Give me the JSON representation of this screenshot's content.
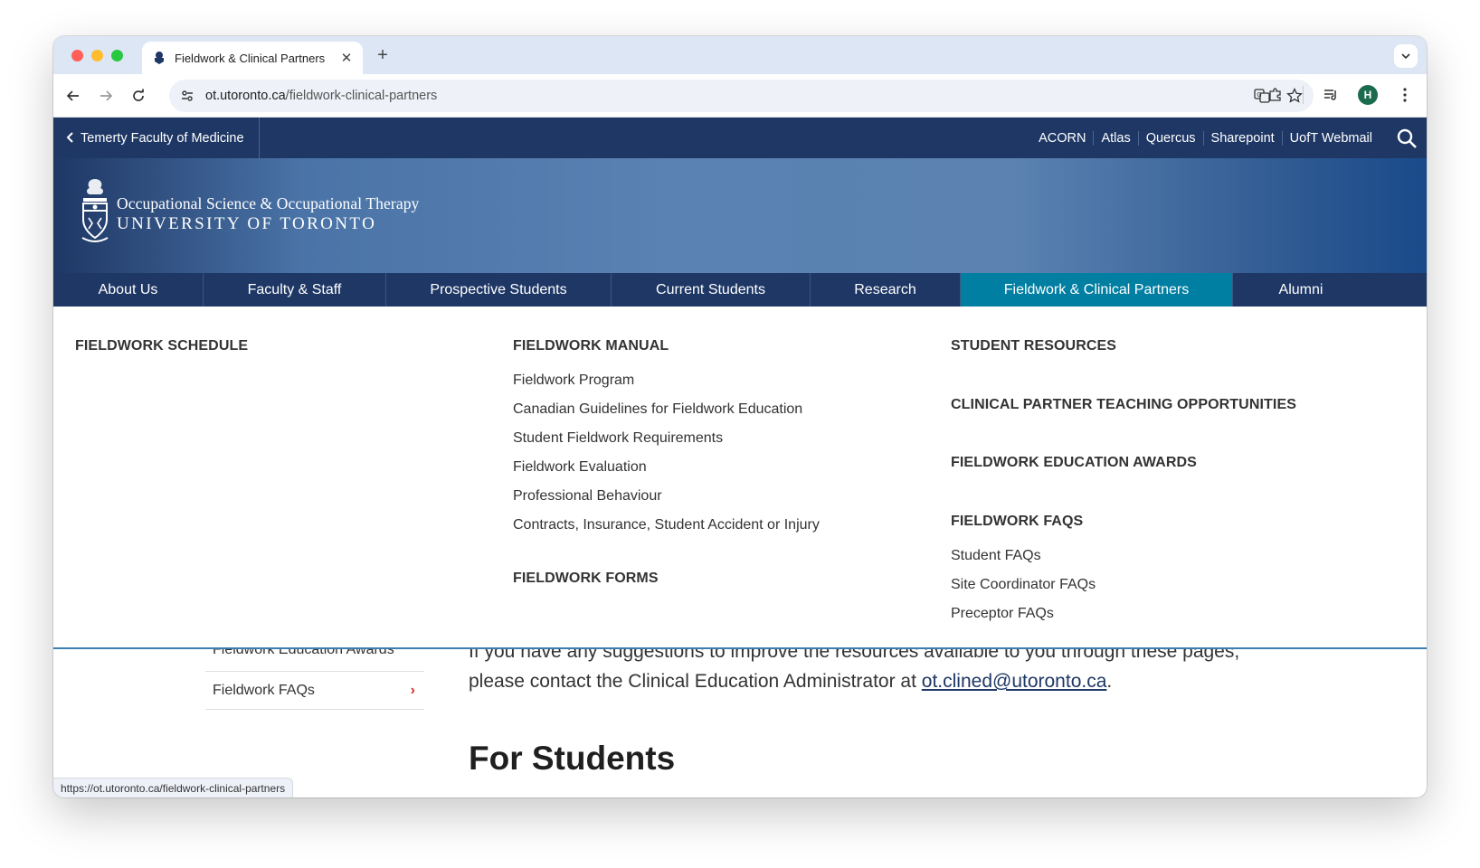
{
  "browser": {
    "tab_title": "Fieldwork & Clinical Partners",
    "new_tab_symbol": "+",
    "close_symbol": "✕",
    "url_host": "ot.utoronto.ca",
    "url_path": "/fieldwork-clinical-partners",
    "profile_initial": "H",
    "status_url": "https://ot.utoronto.ca/fieldwork-clinical-partners"
  },
  "topbar": {
    "back_link": "Temerty Faculty of Medicine",
    "quick_links": [
      "ACORN",
      "Atlas",
      "Quercus",
      "Sharepoint",
      "UofT Webmail"
    ]
  },
  "banner": {
    "line1": "Occupational Science & Occupational Therapy",
    "line2": "UNIVERSITY OF TORONTO"
  },
  "mainnav": {
    "items": [
      "About Us",
      "Faculty & Staff",
      "Prospective Students",
      "Current Students",
      "Research",
      "Fieldwork & Clinical Partners",
      "Alumni"
    ],
    "active": "Fieldwork & Clinical Partners"
  },
  "megamenu": {
    "col1": {
      "heading": "FIELDWORK SCHEDULE"
    },
    "col2": {
      "heading": "FIELDWORK MANUAL",
      "links": [
        "Fieldwork Program",
        "Canadian Guidelines for Fieldwork Education",
        "Student Fieldwork Requirements",
        "Fieldwork Evaluation",
        "Professional Behaviour",
        "Contracts, Insurance, Student Accident or Injury"
      ],
      "heading2": "FIELDWORK FORMS"
    },
    "col3": {
      "heading1": "STUDENT RESOURCES",
      "heading2": "CLINICAL PARTNER TEACHING OPPORTUNITIES",
      "heading3": "FIELDWORK EDUCATION AWARDS",
      "heading4": "FIELDWORK FAQS",
      "links": [
        "Student FAQs",
        "Site Coordinator FAQs",
        "Preceptor FAQs"
      ]
    }
  },
  "content": {
    "sidebar_clipped": "Fieldwork Education Awards",
    "sidebar_item": "Fieldwork FAQs",
    "sidebar_arrow": "›",
    "para_line1": "If you have any suggestions to improve the resources available to you through these pages,",
    "para_line2_prefix": "please contact the Clinical Education Administrator at ",
    "email": "ot.clined@utoronto.ca",
    "para_line2_suffix": ".",
    "heading": "For Students"
  },
  "colors": {
    "navy": "#1e3765",
    "active_tab": "#007fa3",
    "link": "#1e3765",
    "arrow": "#d0302f"
  }
}
